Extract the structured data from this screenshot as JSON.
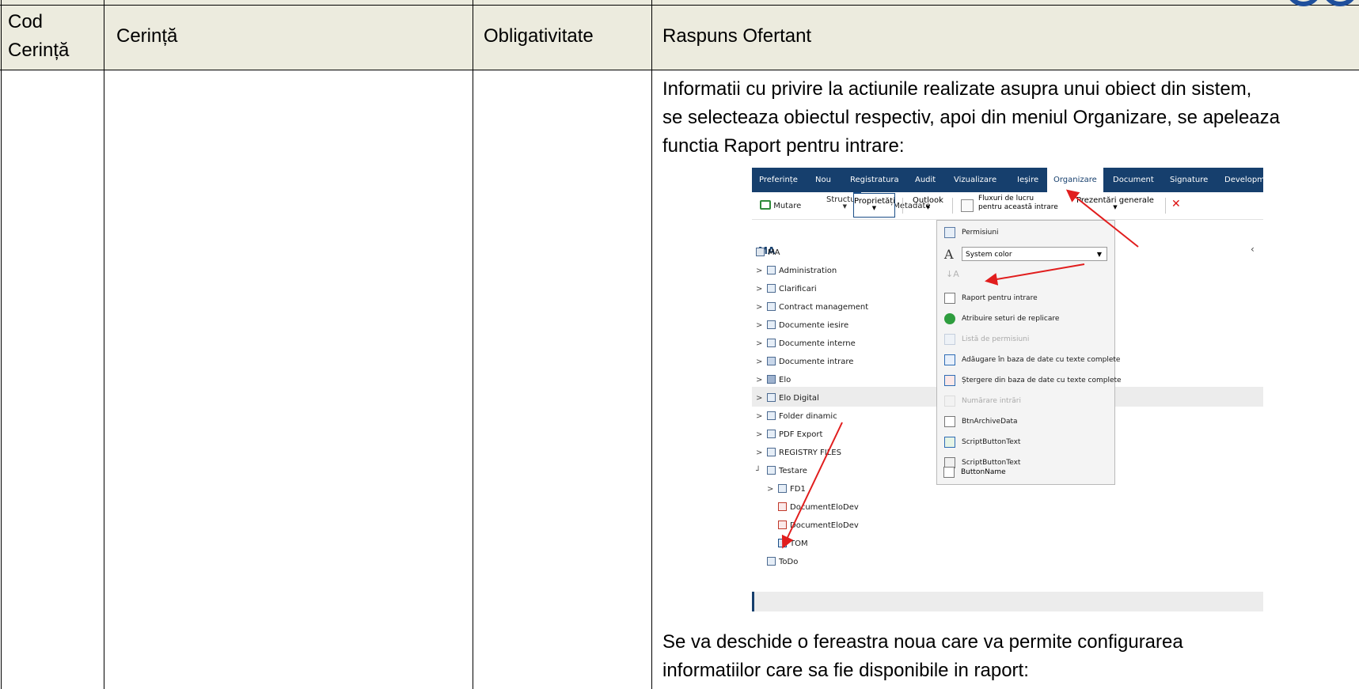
{
  "table": {
    "headers": {
      "code_line1": "Cod",
      "code_line2": "Cerință",
      "requirement": "Cerință",
      "mandatory": "Obligativitate",
      "response": "Raspuns Ofertant"
    },
    "intro_lines": [
      "Informatii cu privire la actiunile realizate asupra unui obiect din sistem,",
      "se selecteaza obiectul respectiv, apoi din meniul Organizare, se apeleaza",
      "functia Raport pentru intrare:"
    ],
    "outro_lines": [
      "Se va deschide o fereastra noua care va permite configurarea",
      "informatiilor care sa fie disponibile in raport:"
    ]
  },
  "screenshot": {
    "menu": [
      "Preferințe",
      "Nou",
      "Registratura",
      "Audit",
      "Vizualizare",
      "Ieșire",
      "Organizare",
      "Document",
      "Signature",
      "Developm"
    ],
    "active_menu": "Organizare",
    "ribbon": {
      "mutare": "Mutare",
      "structura": "Structură",
      "metadate": "Metadate",
      "proprietati": "Proprietăți",
      "outlook": "Outlook",
      "fluxuri_line1": "Fluxuri de lucru",
      "fluxuri_line2": "pentru această intrare",
      "prezentari": "Prezentări generale"
    },
    "panel_title": "MA",
    "collapse_icon": "chevron-left-icon",
    "tree": [
      {
        "label": "MA",
        "icon": "repository-icon"
      },
      {
        "label": "Administration",
        "icon": "folder-icon"
      },
      {
        "label": "Clarificari",
        "icon": "folder-icon"
      },
      {
        "label": "Contract management",
        "icon": "folder-icon"
      },
      {
        "label": "Documente iesire",
        "icon": "folder-icon"
      },
      {
        "label": "Documente interne",
        "icon": "folder-icon"
      },
      {
        "label": "Documente intrare",
        "icon": "folder-icon"
      },
      {
        "label": "Elo",
        "icon": "folder-icon"
      },
      {
        "label": "Elo Digital",
        "icon": "folder-icon"
      },
      {
        "label": "Folder dinamic",
        "icon": "folder-icon"
      },
      {
        "label": "PDF Export",
        "icon": "folder-icon"
      },
      {
        "label": "REGISTRY FILES",
        "icon": "folder-icon"
      },
      {
        "label": "Testare",
        "icon": "folder-icon"
      },
      {
        "label": "FD1",
        "icon": "folder-icon"
      },
      {
        "label": "DocumentEloDev",
        "icon": "pdf-icon"
      },
      {
        "label": "DocumentEloDev",
        "icon": "pdf-icon"
      },
      {
        "label": "TOM",
        "icon": "document-icon"
      },
      {
        "label": "ToDo",
        "icon": "folder-icon"
      }
    ],
    "dropdown": {
      "permisiuni": "Permisiuni",
      "system_color": "System color",
      "items": [
        {
          "label": "Raport pentru intrare",
          "enabled": true,
          "icon": "report-icon"
        },
        {
          "label": "Atribuire seturi de replicare",
          "enabled": true,
          "icon": "replication-icon"
        },
        {
          "label": "Listă de permisiuni",
          "enabled": false,
          "icon": "permissions-list-icon"
        },
        {
          "label": "Adăugare în baza de date cu texte complete",
          "enabled": true,
          "icon": "fulltext-add-icon"
        },
        {
          "label": "Ștergere din baza de date cu texte complete",
          "enabled": true,
          "icon": "fulltext-delete-icon"
        },
        {
          "label": "Numărare intrări",
          "enabled": false,
          "icon": "count-icon"
        },
        {
          "label": "BtnArchiveData",
          "enabled": true,
          "icon": "archive-data-icon"
        },
        {
          "label": "ScriptButtonText",
          "enabled": true,
          "icon": "script-icon"
        },
        {
          "label": "ScriptButtonText",
          "enabled": true,
          "icon": "script-icon"
        },
        {
          "label": "ButtonName",
          "enabled": true,
          "icon": "button-icon"
        }
      ]
    },
    "colors": {
      "menu_bg": "#163f6d",
      "arrow": "#e11d1d",
      "header_bg": "#ecebde"
    }
  }
}
